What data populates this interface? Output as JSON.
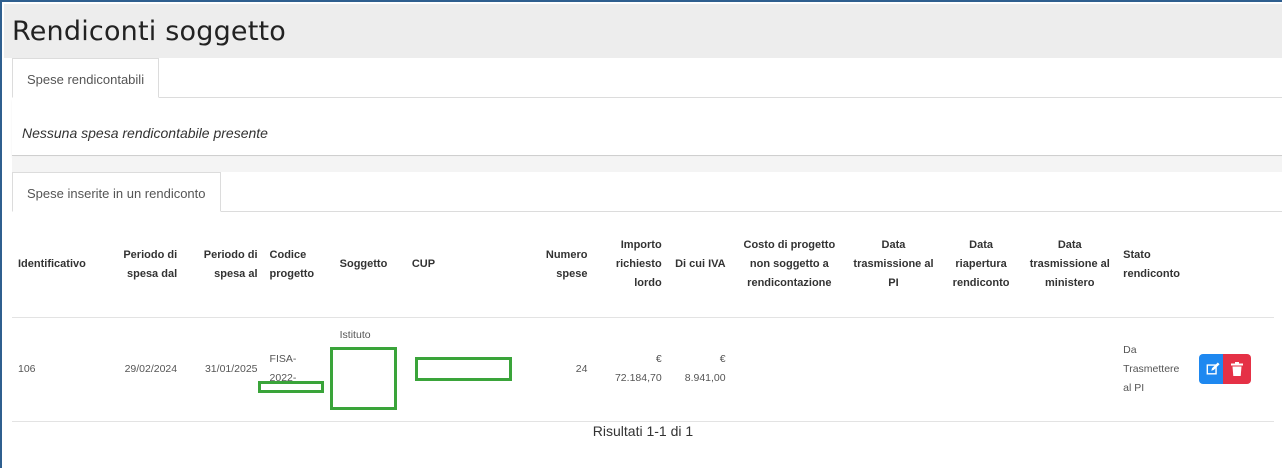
{
  "page": {
    "title": "Rendiconti soggetto"
  },
  "tabs": {
    "spese_rendicontabili": "Spese rendicontabili",
    "spese_inserite": "Spese inserite in un rendiconto"
  },
  "empty_message": "Nessuna spesa rendicontabile presente",
  "table": {
    "headers": [
      "Identificativo",
      "Periodo di spesa dal",
      "Periodo di spesa al",
      "Codice progetto",
      "Soggetto",
      "CUP",
      "Numero spese",
      "Importo richiesto lordo",
      "Di cui IVA",
      "Costo di progetto non soggetto a rendicontazione",
      "Data trasmissione al PI",
      "Data riapertura rendiconto",
      "Data trasmissione al ministero",
      "Stato rendiconto"
    ],
    "rows": [
      {
        "identificativo": "106",
        "periodo_dal": "29/02/2024",
        "periodo_al": "31/01/2025",
        "codice_progetto_1": "FISA-",
        "codice_progetto_2": "2022-",
        "soggetto": "Istituto",
        "cup": "",
        "numero_spese": "24",
        "importo_currency": "€",
        "importo_value": "72.184,70",
        "iva_currency": "€",
        "iva_value": "8.941,00",
        "costo_non_soggetto": "",
        "data_trasmissione_pi": "",
        "data_riapertura": "",
        "data_trasmissione_ministero": "",
        "stato": "Da Trasmettere al PI"
      }
    ]
  },
  "pagination": {
    "results_text": "Risultati 1-1 di 1"
  },
  "colors": {
    "edit_button": "#1e88f0",
    "delete_button": "#e53146",
    "redaction_box": "#3aa43a"
  },
  "icons": {
    "edit": "edit-icon",
    "delete": "trash-icon"
  }
}
